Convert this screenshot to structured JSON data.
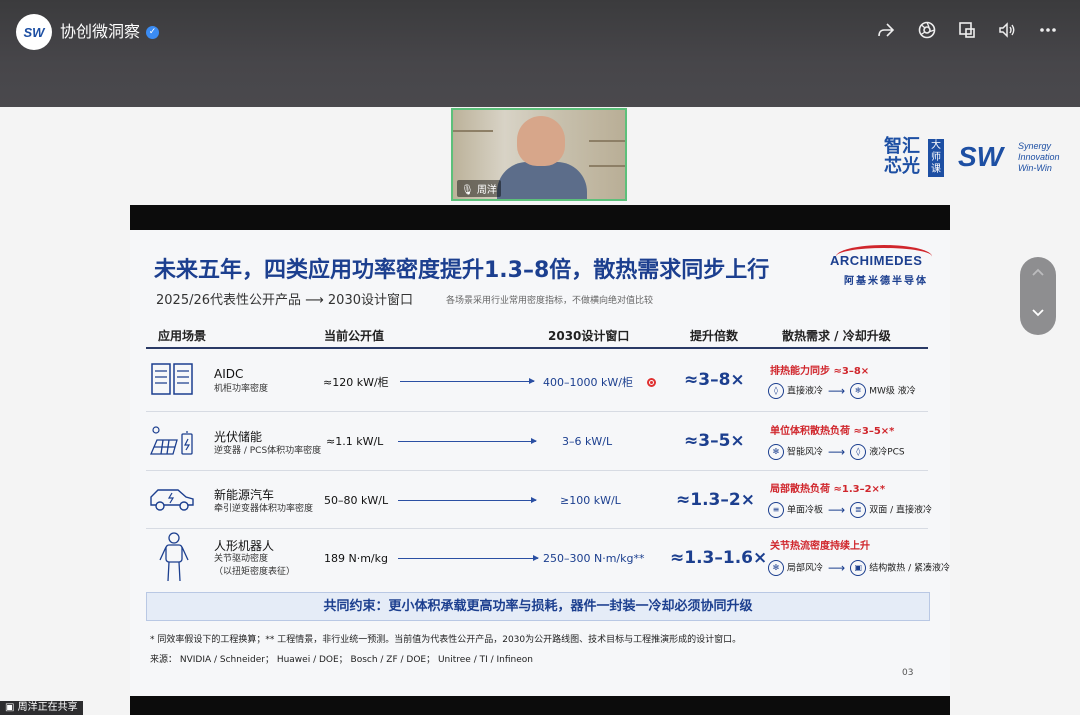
{
  "header": {
    "logo_text": "SW",
    "channel_name": "协创微洞察",
    "verified_mark": "✓",
    "icons": [
      "share-icon",
      "camera-icon",
      "pip-icon",
      "volume-icon",
      "more-icon"
    ]
  },
  "camera": {
    "label": "周洋"
  },
  "brand": {
    "zh": "智汇芯光",
    "badge": "大师课",
    "sw": "SW",
    "en_line1": "Synergy",
    "en_line2": "Innovation",
    "en_line3": "Win-Win"
  },
  "slide": {
    "title": "未来五年，四类应用功率密度提升1.3–8倍，散热需求同步上行",
    "subtitle": "2025/26代表性公开产品  ⟶  2030设计窗口",
    "note": "各场景采用行业常用密度指标，不做横向绝对值比较",
    "company_en": "ARCHIMEDES",
    "company_zh": "阿基米德半导体",
    "headers": {
      "scene": "应用场景",
      "current": "当前公开值",
      "window": "2030设计窗口",
      "mult": "提升倍数",
      "cooling": "散热需求 / 冷却升级"
    },
    "rows": [
      {
        "icon": "server-rack-icon",
        "name": "AIDC",
        "desc": "机柜功率密度",
        "desc2": "",
        "current": "≈120 kW/柜",
        "target": "400–1000 kW/柜",
        "mult": "≈3–8×",
        "need": "排热能力同步 ≈3–8×",
        "from_icon": "◊",
        "from": "直接液冷",
        "to_icon": "❄",
        "to": "MW级 液冷"
      },
      {
        "icon": "solar-battery-icon",
        "name": "光伏储能",
        "desc": "逆变器 / PCS体积功率密度",
        "desc2": "",
        "current": "≈1.1 kW/L",
        "target": "3–6 kW/L",
        "mult": "≈3–5×",
        "need": "单位体积散热负荷 ≈3–5×*",
        "from_icon": "✻",
        "from": "智能风冷",
        "to_icon": "◊",
        "to": "液冷PCS"
      },
      {
        "icon": "electric-car-icon",
        "name": "新能源汽车",
        "desc": "牵引逆变器体积功率密度",
        "desc2": "",
        "current": "50–80 kW/L",
        "target": "≥100 kW/L",
        "mult": "≈1.3–2×",
        "need": "局部散热负荷 ≈1.3–2×*",
        "from_icon": "≡",
        "from": "单面冷板",
        "to_icon": "≣",
        "to": "双面 / 直接液冷"
      },
      {
        "icon": "humanoid-robot-icon",
        "name": "人形机器人",
        "desc": "关节驱动密度",
        "desc2": "（以扭矩密度表征）",
        "current": "189 N·m/kg",
        "target": "250–300 N·m/kg**",
        "mult": "≈1.3–1.6×",
        "need": "关节热流密度持续上升",
        "from_icon": "✻",
        "from": "局部风冷",
        "to_icon": "▣",
        "to": "结构散热 / 紧凑液冷"
      }
    ],
    "consensus": "共同约束：更小体积承载更高功率与损耗，器件一封装一冷却必须协同升级",
    "footnote1": "* 同效率假设下的工程换算；** 工程情景，非行业统一预测。当前值为代表性公开产品，2030为公开路线图、技术目标与工程推演形成的设计窗口。",
    "footnote2": "来源：  NVIDIA / Schneider；  Huawei / DOE；  Bosch / ZF / DOE；  Unitree / TI / Infineon",
    "page": "03"
  },
  "share_status": "周洋正在共享",
  "colors": {
    "accent_blue": "#1c3f8f",
    "accent_red": "#d0262c",
    "cam_border": "#5cc07a"
  }
}
